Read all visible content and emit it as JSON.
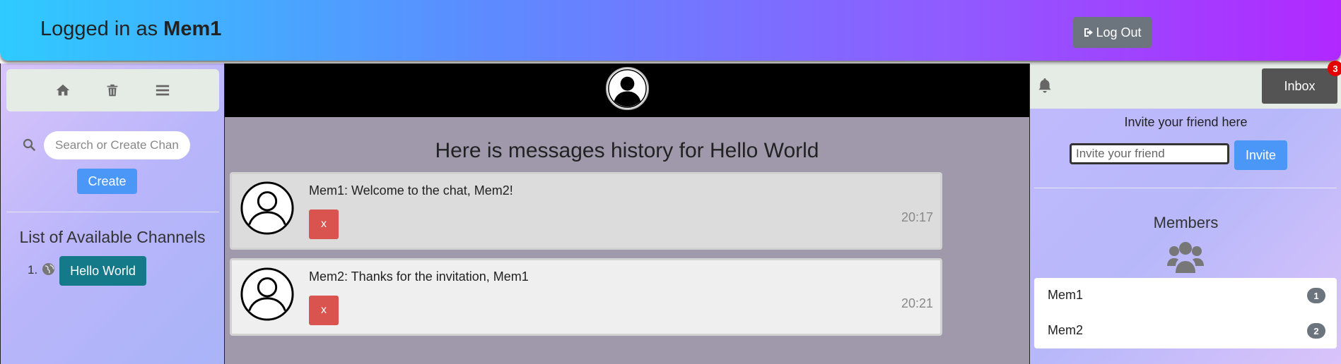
{
  "header": {
    "login_prefix": "Logged in as",
    "username": "Mem1",
    "logout_label": "Log Out"
  },
  "left_sidebar": {
    "toolbar": [
      {
        "icon": "home-icon"
      },
      {
        "icon": "trash-icon"
      },
      {
        "icon": "menu-icon"
      }
    ],
    "search": {
      "placeholder": "Search or Create Channel",
      "value": ""
    },
    "create_label": "Create",
    "channels_title": "List of Available Channels",
    "channels": [
      {
        "number": "1.",
        "icon": "globe-icon",
        "name": "Hello World"
      }
    ]
  },
  "chat": {
    "history_title": "Here is messages history for Hello World",
    "messages": [
      {
        "text": "Mem1: Welcome to the chat, Mem2!",
        "delete_label": "x",
        "time": "20:17"
      },
      {
        "text": "Mem2: Thanks for the invitation, Mem1",
        "delete_label": "x",
        "time": "20:21"
      }
    ]
  },
  "right_sidebar": {
    "inbox_label": "Inbox",
    "inbox_count": "3",
    "invite_label": "Invite your friend here",
    "invite_input": {
      "placeholder": "Invite your friend",
      "value": ""
    },
    "invite_button": "Invite",
    "members_title": "Members",
    "members": [
      {
        "name": "Mem1",
        "badge": "1"
      },
      {
        "name": "Mem2",
        "badge": "2"
      }
    ]
  },
  "colors": {
    "header_gradient_start": "#2ecbff",
    "header_gradient_end": "#b128ff",
    "primary_button": "#4a97f8",
    "channel_button": "#147a8a",
    "delete_button": "#d9534f",
    "inbox_button": "#545454",
    "badge_red": "#e50000"
  }
}
